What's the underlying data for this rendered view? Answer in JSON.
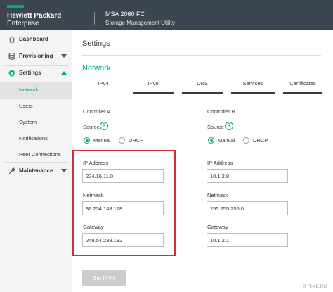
{
  "header": {
    "brand_line1": "Hewlett Packard",
    "brand_line2": "Enterprise",
    "product_name": "MSA 2060 FC",
    "product_subtitle": "Storage Management Utility",
    "brand_accent": "#01a982",
    "bar_color": "#3c4650"
  },
  "sidebar": {
    "items": [
      {
        "label": "Dashboard",
        "icon": "home-icon"
      },
      {
        "label": "Provisioning",
        "icon": "database-icon",
        "expanded": false
      },
      {
        "label": "Settings",
        "icon": "gear-icon",
        "expanded": true
      },
      {
        "label": "Maintenance",
        "icon": "wrench-icon",
        "expanded": false
      }
    ],
    "settings_subitems": [
      "Network",
      "Users",
      "System",
      "Notifications",
      "Peer Connections"
    ],
    "active_subitem": "Network"
  },
  "main": {
    "page_title": "Settings",
    "section_title": "Network",
    "tabs": [
      "IPv4",
      "IPv6",
      "DNS",
      "Services",
      "Certificates"
    ],
    "active_tab": "IPv4"
  },
  "controller_a": {
    "heading": "Controller A",
    "source_label": "Source",
    "source_options": [
      "Manual",
      "DHCP"
    ],
    "source_selected": "Manual",
    "ip_label": "IP Address",
    "ip_value": "224.16.11.0",
    "netmask_label": "Netmask",
    "netmask_value": "92.234.143.178",
    "gateway_label": "Gateway",
    "gateway_value": "248.54.238.182"
  },
  "controller_b": {
    "heading": "Controller B",
    "source_label": "Source",
    "source_options": [
      "Manual",
      "DHCP"
    ],
    "source_selected": "Manual",
    "ip_label": "IP Address",
    "ip_value": "10.1.2.8",
    "netmask_label": "Netmask",
    "netmask_value": "255.255.255.0",
    "gateway_label": "Gateway",
    "gateway_value": "10.1.2.1"
  },
  "actions": {
    "set_button_label": "Set IPV4",
    "set_button_enabled": false
  },
  "help_glyph": "?",
  "watermark": "© IT-KB.RU",
  "highlight_color": "#d12e35"
}
